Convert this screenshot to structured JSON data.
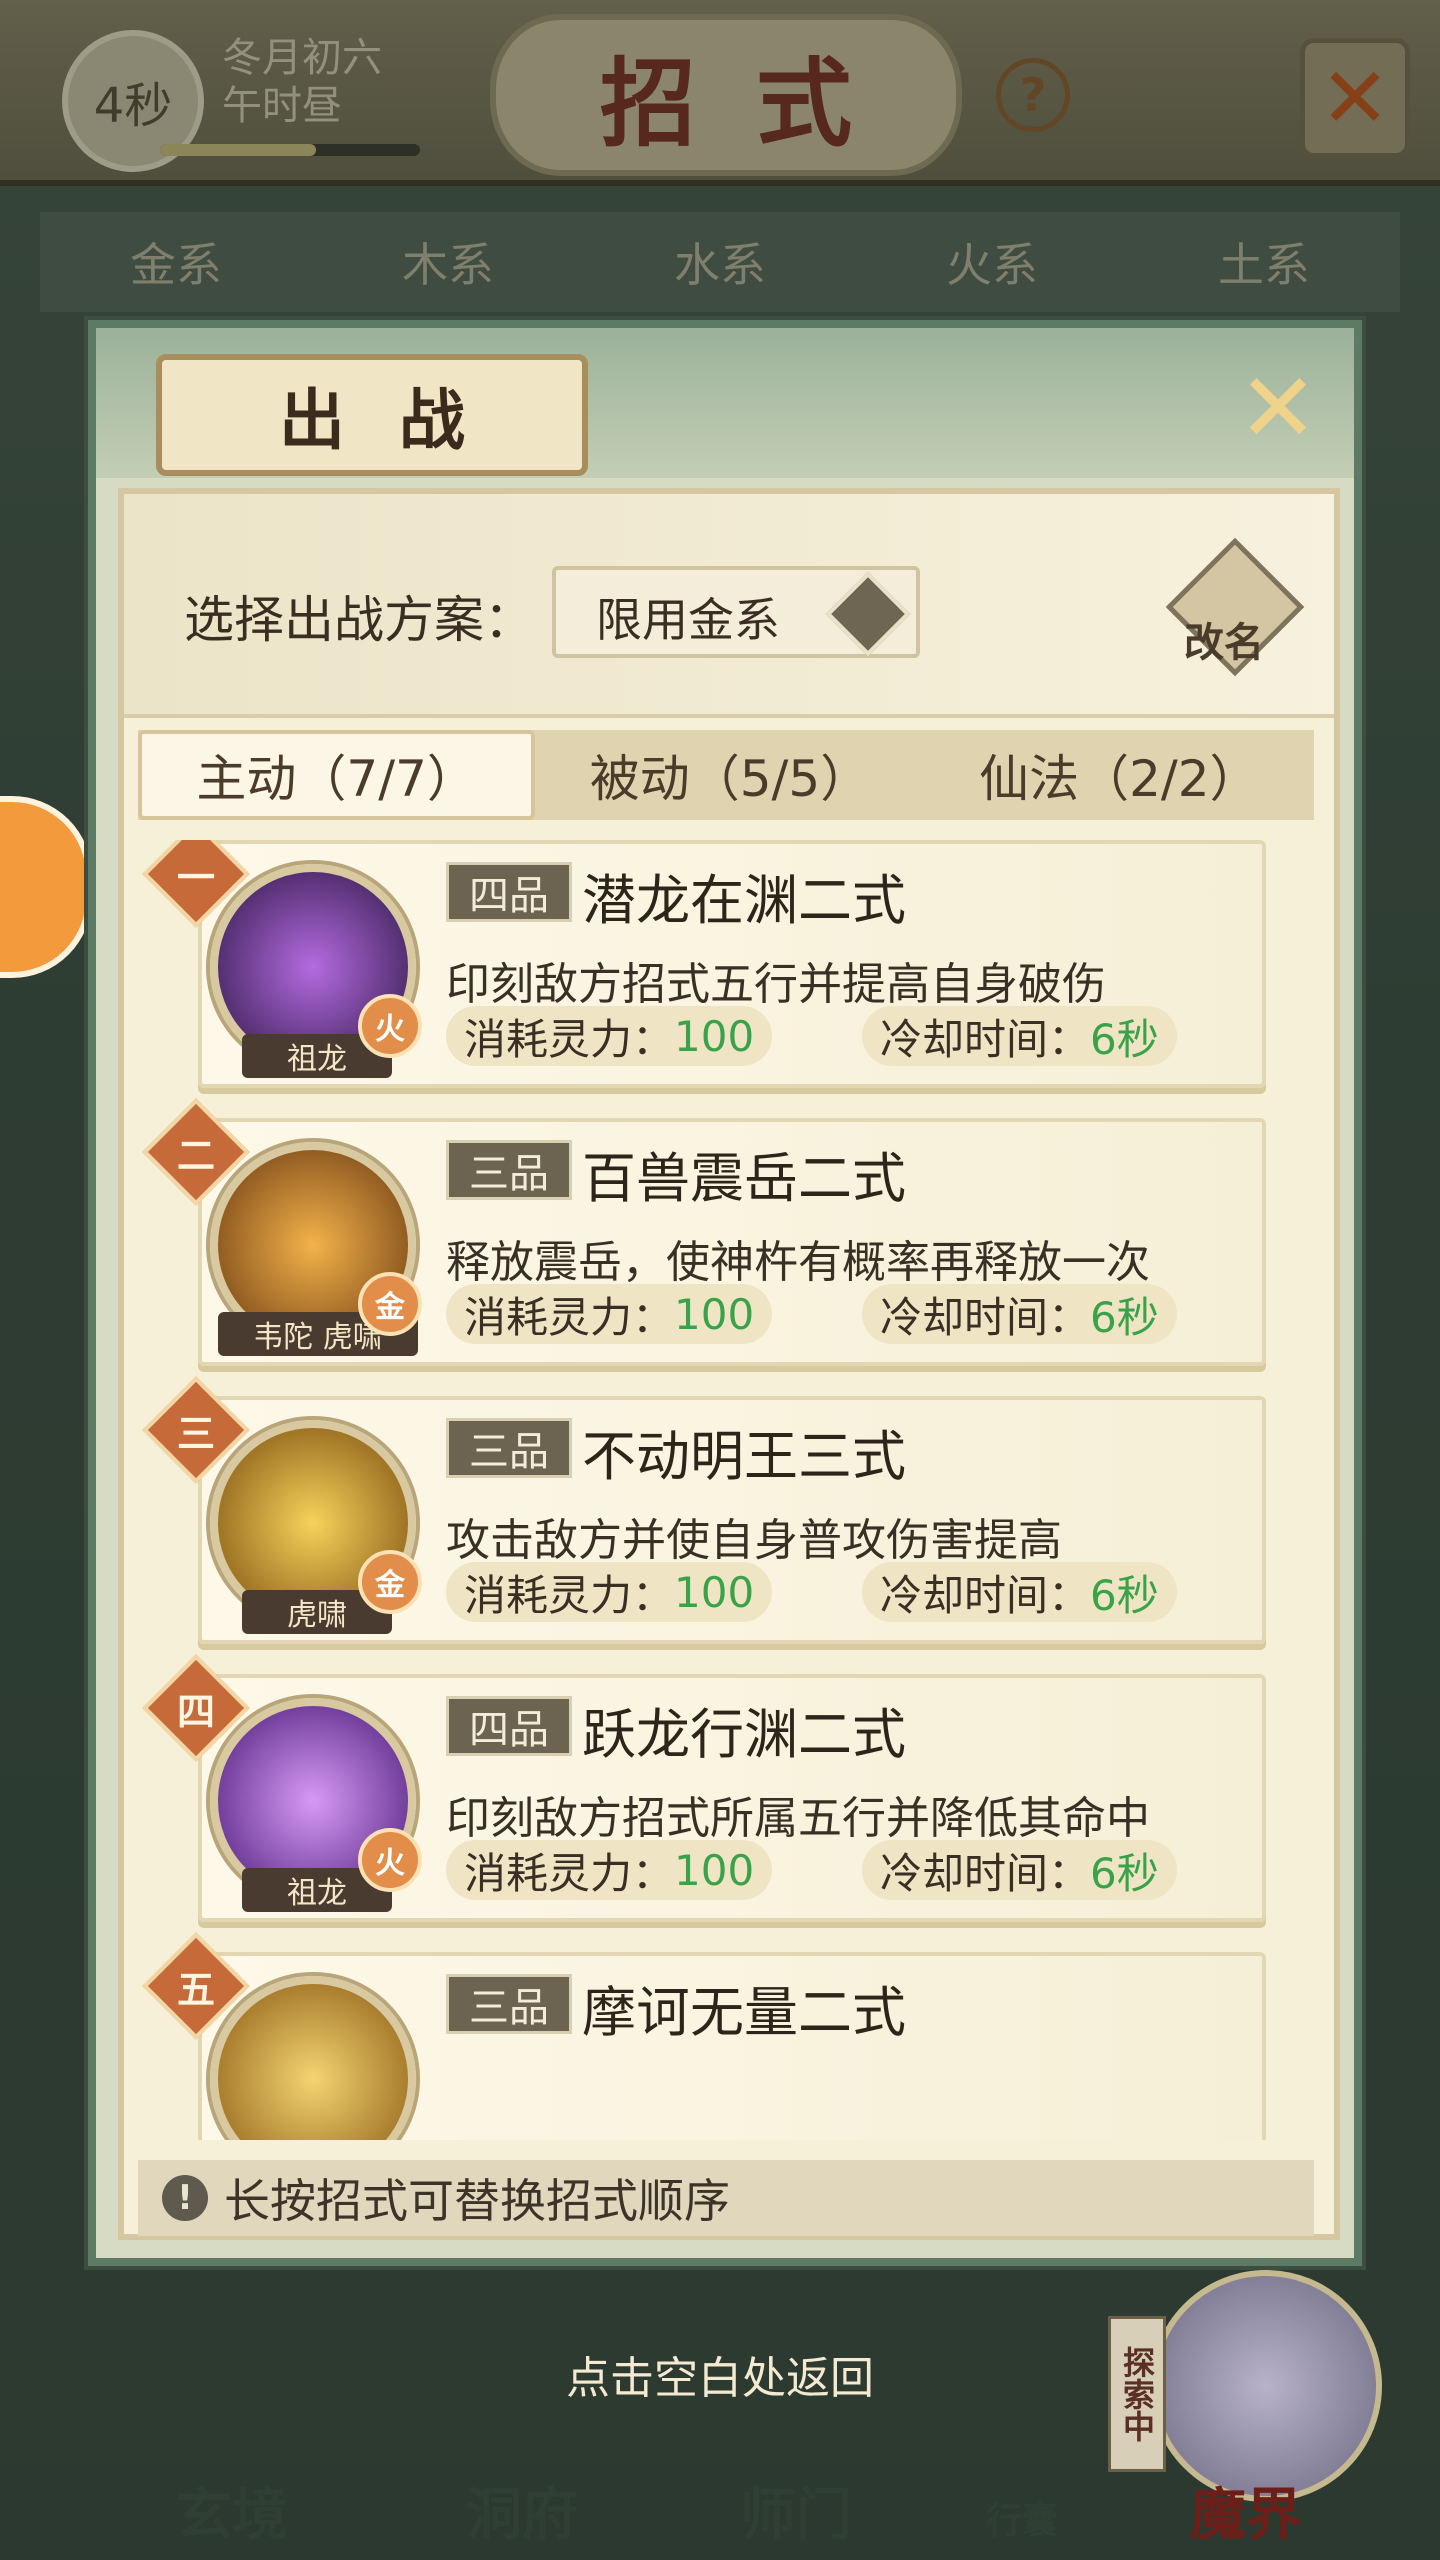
{
  "top": {
    "timer": "4秒",
    "date_line1": "冬月初六",
    "date_line2": "午时昼",
    "title": "招式",
    "help": "?"
  },
  "element_tabs": [
    "金系",
    "木系",
    "水系",
    "火系",
    "土系"
  ],
  "panel": {
    "title": "出战",
    "scheme_label": "选择出战方案：",
    "scheme_value": "限用金系",
    "rename": "改名",
    "subtabs": [
      "主动（7/7）",
      "被动（5/5）",
      "仙法（2/2）"
    ],
    "active_subtab": 0,
    "cost_label": "消耗灵力：",
    "cooldown_label": "冷却时间：",
    "skills": [
      {
        "index": "一",
        "grade": "四品",
        "name": "潜龙在渊二式",
        "desc": "印刻敌方招式五行并提高自身破伤",
        "owner": "祖龙",
        "element": "火",
        "cost": "100",
        "cooldown": "6秒"
      },
      {
        "index": "二",
        "grade": "三品",
        "name": "百兽震岳二式",
        "desc": "释放震岳，使神杵有概率再释放一次",
        "owner": "韦陀 虎啸",
        "element": "金",
        "cost": "100",
        "cooldown": "6秒"
      },
      {
        "index": "三",
        "grade": "三品",
        "name": "不动明王三式",
        "desc": "攻击敌方并使自身普攻伤害提高",
        "owner": "虎啸",
        "element": "金",
        "cost": "100",
        "cooldown": "6秒"
      },
      {
        "index": "四",
        "grade": "四品",
        "name": "跃龙行渊二式",
        "desc": "印刻敌方招式所属五行并降低其命中",
        "owner": "祖龙",
        "element": "火",
        "cost": "100",
        "cooldown": "6秒"
      },
      {
        "index": "五",
        "grade": "三品",
        "name": "摩诃无量二式",
        "desc": "",
        "owner": "",
        "element": "",
        "cost": "",
        "cooldown": ""
      }
    ],
    "hint": "长按招式可替换招式顺序"
  },
  "bottom": {
    "tap_back": "点击空白处返回",
    "nav": [
      "玄境",
      "洞府",
      "师门",
      "行囊",
      "魔界"
    ],
    "exploring": "探索中"
  },
  "colors": {
    "accent_green": "#3aa34a",
    "title_red": "#7a2f22",
    "badge_orange": "#c76a3a"
  }
}
